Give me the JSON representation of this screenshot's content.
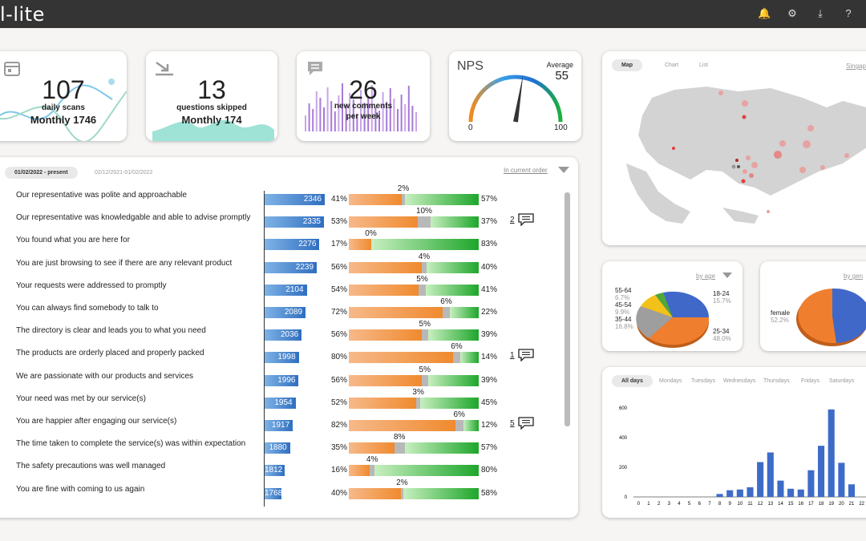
{
  "app": {
    "brand": "l-lite",
    "icons": [
      "bell-icon",
      "gear-icon",
      "download-icon",
      "help-icon"
    ],
    "icon_glyphs": [
      "🔔",
      "⚙",
      "⤓",
      "?"
    ]
  },
  "kpis": [
    {
      "value": "107",
      "label": "daily scans",
      "sub": "Monthly 1746",
      "icon": "calendar-icon"
    },
    {
      "value": "13",
      "label": "questions skipped",
      "sub": "Monthly 174",
      "icon": "skip-arrow-icon"
    },
    {
      "value": "26",
      "label": "new comments",
      "label2": "per week",
      "icon": "comment-icon"
    }
  ],
  "nps": {
    "title": "NPS",
    "avg_label": "Average",
    "avg_value": "55",
    "min": "0",
    "max": "100",
    "value": 55
  },
  "survey": {
    "tabs": [
      "01/02/2022 - present",
      "02/12/2021-01/02/2022"
    ],
    "sort": "In current order",
    "questions": [
      {
        "text": "Our representative was polite and approachable",
        "count": "2346",
        "neg": "41%",
        "neu": "2%",
        "pos": "57%",
        "n": 41,
        "u": 2,
        "comments": ""
      },
      {
        "text": "Our representative was knowledgable and able to advise promptly",
        "count": "2335",
        "neg": "53%",
        "neu": "10%",
        "pos": "37%",
        "n": 53,
        "u": 10,
        "comments": "2"
      },
      {
        "text": "You found what you are here for",
        "count": "2276",
        "neg": "17%",
        "neu": "0%",
        "pos": "83%",
        "n": 17,
        "u": 0,
        "comments": ""
      },
      {
        "text": "You are just browsing to see if there are any relevant product",
        "count": "2239",
        "neg": "56%",
        "neu": "4%",
        "pos": "40%",
        "n": 56,
        "u": 4,
        "comments": ""
      },
      {
        "text": "Your requests were addressed to promptly",
        "count": "2104",
        "neg": "54%",
        "neu": "5%",
        "pos": "41%",
        "n": 54,
        "u": 5,
        "comments": ""
      },
      {
        "text": "You can always find somebody to talk to",
        "count": "2089",
        "neg": "72%",
        "neu": "6%",
        "pos": "22%",
        "n": 72,
        "u": 6,
        "comments": ""
      },
      {
        "text": "The directory is clear and leads you to what you need",
        "count": "2036",
        "neg": "56%",
        "neu": "5%",
        "pos": "39%",
        "n": 56,
        "u": 5,
        "comments": ""
      },
      {
        "text": "The products are orderly placed and properly packed",
        "count": "1998",
        "neg": "80%",
        "neu": "6%",
        "pos": "14%",
        "n": 80,
        "u": 6,
        "comments": "1"
      },
      {
        "text": "We are passionate with our products and services",
        "count": "1996",
        "neg": "56%",
        "neu": "5%",
        "pos": "39%",
        "n": 56,
        "u": 5,
        "comments": ""
      },
      {
        "text": "Your need was met by our service(s)",
        "count": "1954",
        "neg": "52%",
        "neu": "3%",
        "pos": "45%",
        "n": 52,
        "u": 3,
        "comments": ""
      },
      {
        "text": "You are happier after engaging our service(s)",
        "count": "1917",
        "neg": "82%",
        "neu": "6%",
        "pos": "12%",
        "n": 82,
        "u": 6,
        "comments": "5"
      },
      {
        "text": "The time taken to complete the service(s) was within expectation",
        "count": "1880",
        "neg": "35%",
        "neu": "8%",
        "pos": "57%",
        "n": 35,
        "u": 8,
        "comments": ""
      },
      {
        "text": "The safety precautions was well managed",
        "count": "1812",
        "neg": "16%",
        "neu": "4%",
        "pos": "80%",
        "n": 16,
        "u": 4,
        "comments": ""
      },
      {
        "text": "You are fine with coming to us again",
        "count": "1768",
        "neg": "40%",
        "neu": "2%",
        "pos": "58%",
        "n": 40,
        "u": 2,
        "comments": ""
      }
    ]
  },
  "map": {
    "tabs": [
      "Map",
      "Chart",
      "List"
    ],
    "region": "Singap"
  },
  "age": {
    "title": "by age",
    "labels": [
      {
        "name": "55-64",
        "pct": "6.7%"
      },
      {
        "name": "45-54",
        "pct": "9.9%"
      },
      {
        "name": "35-44",
        "pct": "16.8%"
      },
      {
        "name": "18-24",
        "pct": "15.7%"
      },
      {
        "name": "25-34",
        "pct": "48.0%"
      }
    ]
  },
  "gender": {
    "title": "by gen",
    "female_label": "female",
    "female_pct": "52.2%"
  },
  "daily": {
    "tabs": [
      "All days",
      "Mondays",
      "Tuesdays",
      "Wednesdays",
      "Thursdays",
      "Fridays",
      "Saturdays"
    ]
  },
  "chart_data": {
    "type": "bar",
    "categories": [
      "0",
      "1",
      "2",
      "3",
      "4",
      "5",
      "6",
      "7",
      "8",
      "9",
      "10",
      "11",
      "12",
      "13",
      "14",
      "15",
      "16",
      "17",
      "18",
      "19",
      "20",
      "21",
      "22"
    ],
    "values": [
      0,
      0,
      0,
      0,
      0,
      0,
      0,
      0,
      20,
      45,
      50,
      65,
      235,
      300,
      110,
      55,
      50,
      180,
      345,
      590,
      230,
      85,
      0
    ],
    "ylim": [
      0,
      600
    ],
    "yticks": [
      "0",
      "200",
      "400",
      "600"
    ],
    "color": "#3d6cc8",
    "grid": false
  }
}
